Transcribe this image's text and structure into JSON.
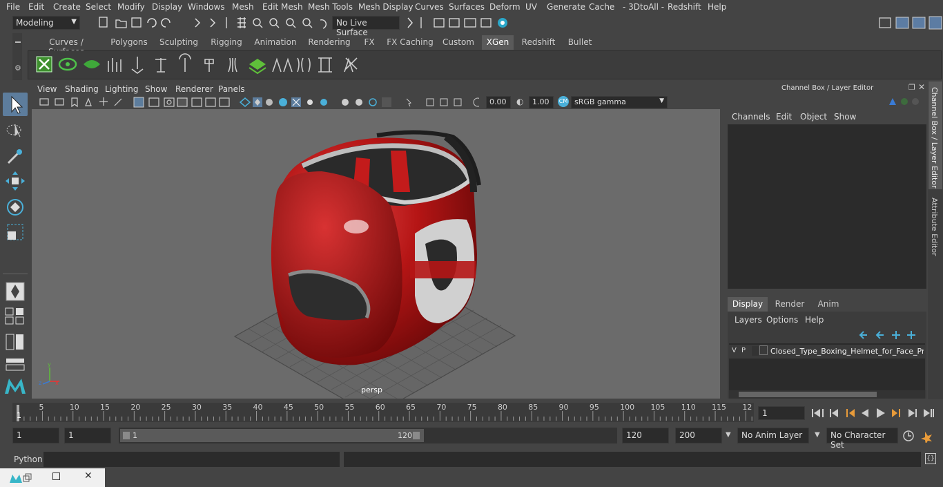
{
  "menu": [
    "File",
    "Edit",
    "Create",
    "Select",
    "Modify",
    "Display",
    "Windows",
    "Mesh",
    "Edit Mesh",
    "Mesh Tools",
    "Mesh Display",
    "Curves",
    "Surfaces",
    "Deform",
    "UV",
    "Generate",
    "Cache",
    "- 3DtoAll -",
    "Redshift",
    "Help"
  ],
  "status": {
    "mode": "Modeling",
    "live_surface": "No Live Surface"
  },
  "shelf_tabs": [
    "Curves / Surfaces",
    "Polygons",
    "Sculpting",
    "Rigging",
    "Animation",
    "Rendering",
    "FX",
    "FX Caching",
    "Custom",
    "XGen",
    "Redshift",
    "Bullet"
  ],
  "active_shelf_tab": "XGen",
  "viewport": {
    "menu": [
      "View",
      "Shading",
      "Lighting",
      "Show",
      "Renderer",
      "Panels"
    ],
    "exposure": "0.00",
    "gamma": "1.00",
    "color_space": "sRGB gamma",
    "camera_label": "persp"
  },
  "channel_box": {
    "title": "Channel Box / Layer Editor",
    "menu": [
      "Channels",
      "Edit",
      "Object",
      "Show"
    ],
    "layer_tabs": [
      "Display",
      "Render",
      "Anim"
    ],
    "active_layer_tab": "Display",
    "layer_menu": [
      "Layers",
      "Options",
      "Help"
    ],
    "layer": {
      "v": "V",
      "p": "P",
      "name": "Closed_Type_Boxing_Helmet_for_Face_Prote"
    }
  },
  "side_tabs": [
    "Channel Box / Layer Editor",
    "Attribute Editor"
  ],
  "timeline": {
    "ticks": [
      "5",
      "10",
      "15",
      "20",
      "25",
      "30",
      "35",
      "40",
      "45",
      "50",
      "55",
      "60",
      "65",
      "70",
      "75",
      "80",
      "85",
      "90",
      "95",
      "100",
      "105",
      "110",
      "115",
      "12"
    ],
    "start_marker": "1",
    "current_frame": "1"
  },
  "range": {
    "start": "1",
    "playback_start": "1",
    "slider_start": "1",
    "slider_end": "120",
    "playback_end": "120",
    "end": "200",
    "anim_layer": "No Anim Layer",
    "character_set": "No Character Set"
  },
  "command": {
    "label": "Python"
  }
}
